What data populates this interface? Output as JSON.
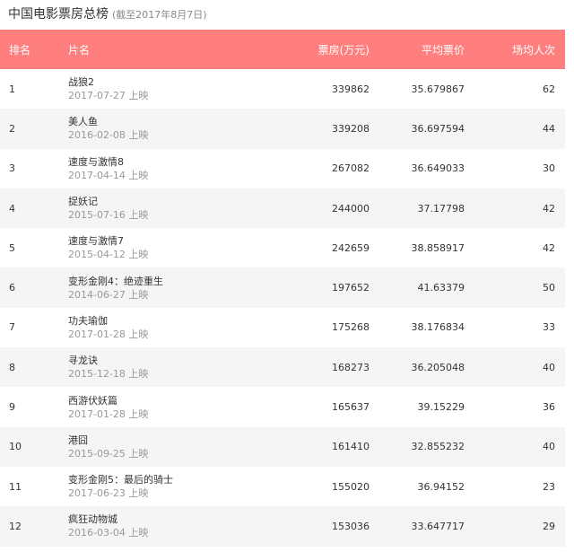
{
  "header": {
    "title": "中国电影票房总榜",
    "subtitle": "(截至2017年8月7日)"
  },
  "table": {
    "columns": [
      "排名",
      "片名",
      "票房(万元)",
      "平均票价",
      "场均人次"
    ],
    "rows": [
      {
        "rank": "1",
        "name": "战狼2",
        "date": "2017-07-27 上映",
        "box": "339862",
        "avg": "35.679867",
        "people": "62"
      },
      {
        "rank": "2",
        "name": "美人鱼",
        "date": "2016-02-08 上映",
        "box": "339208",
        "avg": "36.697594",
        "people": "44"
      },
      {
        "rank": "3",
        "name": "速度与激情8",
        "date": "2017-04-14 上映",
        "box": "267082",
        "avg": "36.649033",
        "people": "30"
      },
      {
        "rank": "4",
        "name": "捉妖记",
        "date": "2015-07-16 上映",
        "box": "244000",
        "avg": "37.17798",
        "people": "42"
      },
      {
        "rank": "5",
        "name": "速度与激情7",
        "date": "2015-04-12 上映",
        "box": "242659",
        "avg": "38.858917",
        "people": "42"
      },
      {
        "rank": "6",
        "name": "变形金刚4：绝迹重生",
        "date": "2014-06-27 上映",
        "box": "197652",
        "avg": "41.63379",
        "people": "50"
      },
      {
        "rank": "7",
        "name": "功夫瑜伽",
        "date": "2017-01-28 上映",
        "box": "175268",
        "avg": "38.176834",
        "people": "33"
      },
      {
        "rank": "8",
        "name": "寻龙诀",
        "date": "2015-12-18 上映",
        "box": "168273",
        "avg": "36.205048",
        "people": "40"
      },
      {
        "rank": "9",
        "name": "西游伏妖篇",
        "date": "2017-01-28 上映",
        "box": "165637",
        "avg": "39.15229",
        "people": "36"
      },
      {
        "rank": "10",
        "name": "港囧",
        "date": "2015-09-25 上映",
        "box": "161410",
        "avg": "32.855232",
        "people": "40"
      },
      {
        "rank": "11",
        "name": "变形金刚5：最后的骑士",
        "date": "2017-06-23 上映",
        "box": "155020",
        "avg": "36.94152",
        "people": "23"
      },
      {
        "rank": "12",
        "name": "疯狂动物城",
        "date": "2016-03-04 上映",
        "box": "153036",
        "avg": "33.647717",
        "people": "29"
      }
    ]
  },
  "colors": {
    "header_bg": "#ff7f7e",
    "row_alt_bg": "#f5f5f5"
  }
}
